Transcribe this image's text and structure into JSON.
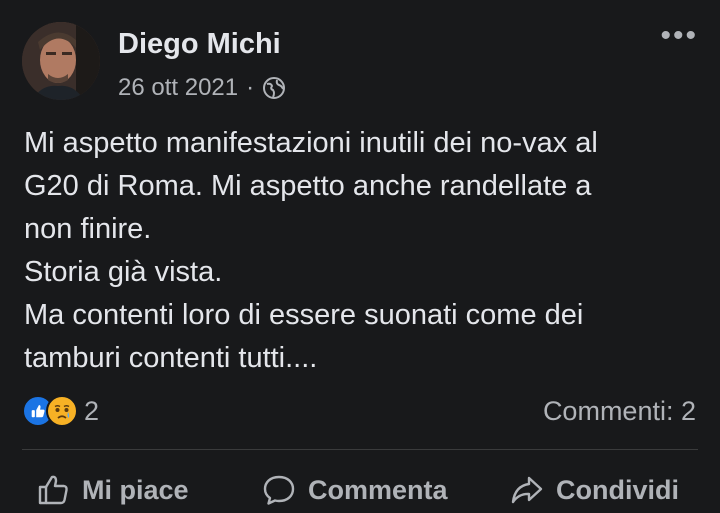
{
  "post": {
    "author": "Diego Michi",
    "date": "26 ott 2021",
    "separator": "·",
    "privacy_icon": "globe-icon",
    "more_label": "•••",
    "lines": [
      "Mi aspetto manifestazioni inutili dei no-vax al",
      "G20 di Roma. Mi aspetto anche randellate a",
      "non finire.",
      "Storia già vista.",
      "Ma contenti loro di essere suonati come dei",
      "tamburi contenti tutti...."
    ]
  },
  "reactions": {
    "icons": [
      "like-icon",
      "sad-icon"
    ],
    "count": "2",
    "comments": "Commenti: 2"
  },
  "actions": {
    "like": "Mi piace",
    "comment": "Commenta",
    "share": "Condividi"
  },
  "colors": {
    "background": "#18191b",
    "text": "#e4e6eb",
    "secondary": "#b0b3b8",
    "like_blue": "#1b74e4",
    "sad_yellow": "#f7b125"
  }
}
